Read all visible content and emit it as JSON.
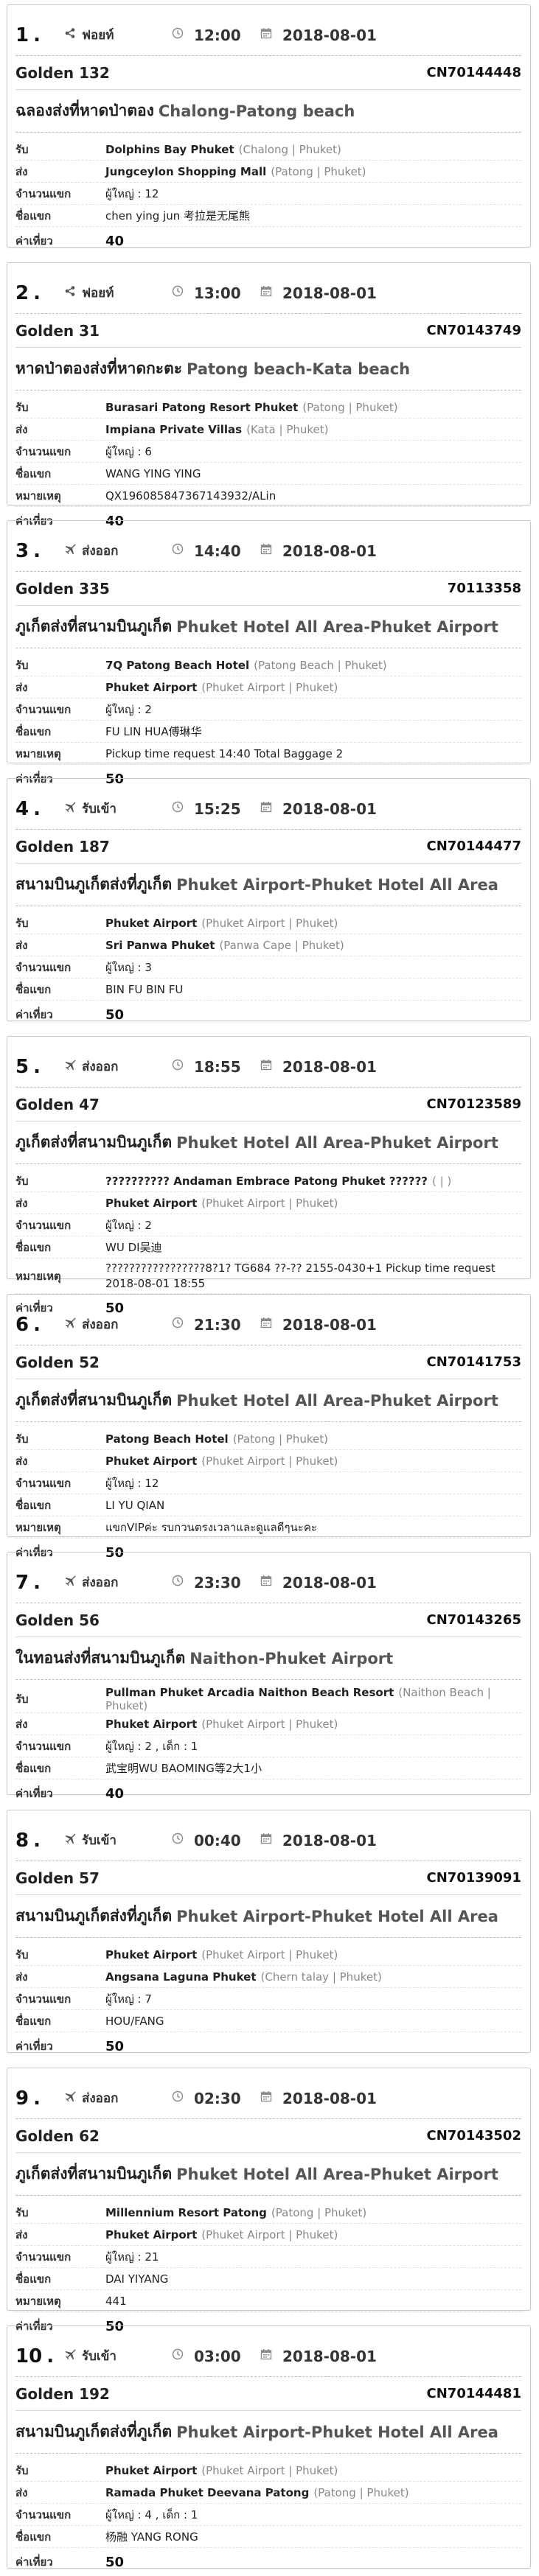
{
  "labels": {
    "pickup": "รับ",
    "dropoff": "ส่ง",
    "pax": "จำนวนแขก",
    "guest": "ชื่อแขก",
    "note": "หมายเหตุ",
    "price": "ค่าเที่ยว"
  },
  "icons": {
    "share": "share-icon",
    "plane": "plane-icon",
    "clock": "clock-icon",
    "calendar": "calendar-icon"
  },
  "orders": [
    {
      "num": "1",
      "service": "ฟอยท์",
      "icon": "share",
      "time": "12:00",
      "date": "2018-08-01",
      "vehicle": "Golden 132",
      "code": "CN70144448",
      "route_th": "ฉลองส่งที่หาดป่าตอง",
      "route_en": "Chalong-Patong beach",
      "pickup": "Dolphins Bay Phuket",
      "pickup_sub": "(Chalong | Phuket)",
      "dropoff": "Jungceylon Shopping Mall",
      "dropoff_sub": "(Patong | Phuket)",
      "pax": "ผู้ใหญ่ : 12",
      "guest": "chen ying jun 考拉是无尾熊",
      "note": null,
      "price": "40"
    },
    {
      "num": "2",
      "service": "ฟอยท์",
      "icon": "share",
      "time": "13:00",
      "date": "2018-08-01",
      "vehicle": "Golden 31",
      "code": "CN70143749",
      "route_th": "หาดป่าตองส่งที่หาดกะตะ",
      "route_en": "Patong beach-Kata beach",
      "pickup": "Burasari Patong Resort Phuket",
      "pickup_sub": "(Patong | Phuket)",
      "dropoff": "Impiana Private Villas",
      "dropoff_sub": "(Kata | Phuket)",
      "pax": "ผู้ใหญ่ : 6",
      "guest": "WANG YING YING",
      "note": "QX196085847367143932/ALin",
      "price": "40"
    },
    {
      "num": "3",
      "service": "ส่งออก",
      "icon": "plane",
      "time": "14:40",
      "date": "2018-08-01",
      "vehicle": "Golden 335",
      "code": "70113358",
      "route_th": "ภูเก็ตส่งที่สนามบินภูเก็ต",
      "route_en": "Phuket Hotel All Area-Phuket Airport",
      "pickup": "7Q Patong Beach Hotel",
      "pickup_sub": "(Patong Beach | Phuket)",
      "dropoff": "Phuket Airport",
      "dropoff_sub": "(Phuket Airport | Phuket)",
      "pax": "ผู้ใหญ่ : 2",
      "guest": "FU LIN HUA傅琳华",
      "note": "Pickup time request 14:40 Total Baggage 2",
      "price": "50"
    },
    {
      "num": "4",
      "service": "รับเข้า",
      "icon": "plane",
      "time": "15:25",
      "date": "2018-08-01",
      "vehicle": "Golden 187",
      "code": "CN70144477",
      "route_th": "สนามบินภูเก็ตส่งที่ภูเก็ต",
      "route_en": "Phuket Airport-Phuket Hotel All Area",
      "pickup": "Phuket Airport",
      "pickup_sub": "(Phuket Airport | Phuket)",
      "dropoff": "Sri Panwa Phuket",
      "dropoff_sub": "(Panwa Cape | Phuket)",
      "pax": "ผู้ใหญ่ : 3",
      "guest": "BIN FU BIN FU",
      "note": null,
      "price": "50"
    },
    {
      "num": "5",
      "service": "ส่งออก",
      "icon": "plane",
      "time": "18:55",
      "date": "2018-08-01",
      "vehicle": "Golden 47",
      "code": "CN70123589",
      "route_th": "ภูเก็ตส่งที่สนามบินภูเก็ต",
      "route_en": "Phuket Hotel All Area-Phuket Airport",
      "pickup": "?????????? Andaman Embrace Patong Phuket ??????",
      "pickup_sub": "( | )",
      "dropoff": "Phuket Airport",
      "dropoff_sub": "(Phuket Airport | Phuket)",
      "pax": "ผู้ใหญ่ : 2",
      "guest": "WU DI吴迪",
      "note": "?????????????????8?1? TG684 ??-?? 2155-0430+1 Pickup time request 2018-08-01 18:55",
      "price": "50"
    },
    {
      "num": "6",
      "service": "ส่งออก",
      "icon": "plane",
      "time": "21:30",
      "date": "2018-08-01",
      "vehicle": "Golden 52",
      "code": "CN70141753",
      "route_th": "ภูเก็ตส่งที่สนามบินภูเก็ต",
      "route_en": "Phuket Hotel All Area-Phuket Airport",
      "pickup": "Patong Beach Hotel",
      "pickup_sub": "(Patong | Phuket)",
      "dropoff": "Phuket Airport",
      "dropoff_sub": "(Phuket Airport | Phuket)",
      "pax": "ผู้ใหญ่ : 12",
      "guest": "LI YU QIAN",
      "note": "แขกVIPค่ะ รบกวนตรงเวลาและดูแลดีๆนะคะ",
      "price": "50"
    },
    {
      "num": "7",
      "service": "ส่งออก",
      "icon": "plane",
      "time": "23:30",
      "date": "2018-08-01",
      "vehicle": "Golden 56",
      "code": "CN70143265",
      "route_th": "ในทอนส่งที่สนามบินภูเก็ต",
      "route_en": "Naithon-Phuket Airport",
      "pickup": "Pullman Phuket Arcadia Naithon Beach Resort",
      "pickup_sub": "(Naithon Beach | Phuket)",
      "dropoff": "Phuket Airport",
      "dropoff_sub": "(Phuket Airport | Phuket)",
      "pax": "ผู้ใหญ่ : 2 , เด็ก : 1",
      "guest": "武宝明WU BAOMING等2大1小",
      "note": null,
      "price": "40"
    },
    {
      "num": "8",
      "service": "รับเข้า",
      "icon": "plane",
      "time": "00:40",
      "date": "2018-08-01",
      "vehicle": "Golden 57",
      "code": "CN70139091",
      "route_th": "สนามบินภูเก็ตส่งที่ภูเก็ต",
      "route_en": "Phuket Airport-Phuket Hotel All Area",
      "pickup": "Phuket Airport",
      "pickup_sub": "(Phuket Airport | Phuket)",
      "dropoff": "Angsana Laguna Phuket",
      "dropoff_sub": "(Chern talay | Phuket)",
      "pax": "ผู้ใหญ่ : 7",
      "guest": "HOU/FANG",
      "note": null,
      "price": "50"
    },
    {
      "num": "9",
      "service": "ส่งออก",
      "icon": "plane",
      "time": "02:30",
      "date": "2018-08-01",
      "vehicle": "Golden 62",
      "code": "CN70143502",
      "route_th": "ภูเก็ตส่งที่สนามบินภูเก็ต",
      "route_en": "Phuket Hotel All Area-Phuket Airport",
      "pickup": "Millennium Resort Patong",
      "pickup_sub": "(Patong | Phuket)",
      "dropoff": "Phuket Airport",
      "dropoff_sub": "(Phuket Airport | Phuket)",
      "pax": "ผู้ใหญ่ : 21",
      "guest": "DAI YIYANG",
      "note": "441",
      "price": "50"
    },
    {
      "num": "10",
      "service": "รับเข้า",
      "icon": "plane",
      "time": "03:00",
      "date": "2018-08-01",
      "vehicle": "Golden 192",
      "code": "CN70144481",
      "route_th": "สนามบินภูเก็ตส่งที่ภูเก็ต",
      "route_en": "Phuket Airport-Phuket Hotel All Area",
      "pickup": "Phuket Airport",
      "pickup_sub": "(Phuket Airport | Phuket)",
      "dropoff": "Ramada Phuket Deevana Patong",
      "dropoff_sub": "(Patong | Phuket)",
      "pax": "ผู้ใหญ่ : 4 , เด็ก : 1",
      "guest": "杨融 YANG RONG",
      "note": null,
      "price": "50"
    }
  ]
}
